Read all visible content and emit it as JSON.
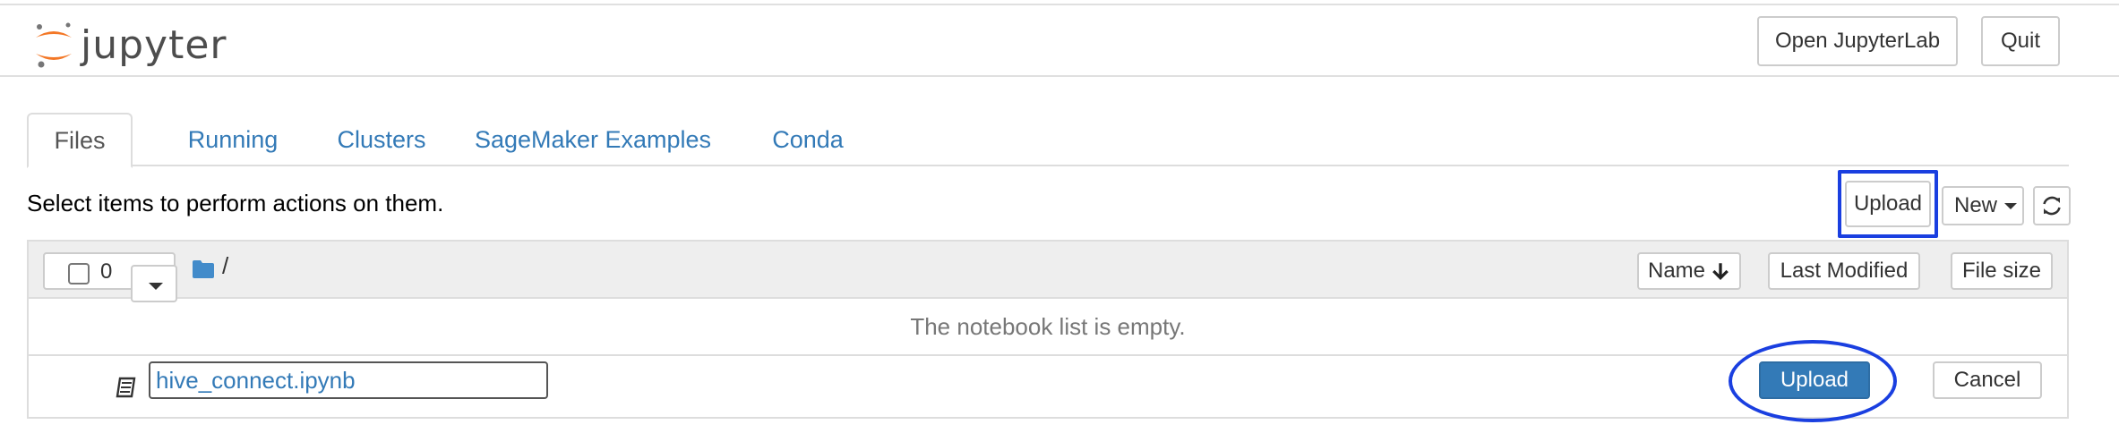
{
  "app": {
    "logo_text": "jupyter"
  },
  "header": {
    "open_jupyterlab_label": "Open JupyterLab",
    "quit_label": "Quit"
  },
  "tabs": [
    {
      "label": "Files",
      "active": true
    },
    {
      "label": "Running",
      "active": false
    },
    {
      "label": "Clusters",
      "active": false
    },
    {
      "label": "SageMaker Examples",
      "active": false
    },
    {
      "label": "Conda",
      "active": false
    }
  ],
  "toolbar": {
    "instructions": "Select items to perform actions on them.",
    "upload_label": "Upload",
    "new_label": "New",
    "refresh_icon": "refresh-icon"
  },
  "list_header": {
    "selected_count": "0",
    "path": "/",
    "name_label": "Name",
    "last_modified_label": "Last Modified",
    "file_size_label": "File size"
  },
  "list": {
    "empty_message": "The notebook list is empty."
  },
  "upload_row": {
    "filename": "hive_connect.ipynb",
    "upload_label": "Upload",
    "cancel_label": "Cancel"
  },
  "colors": {
    "link": "#337ab7",
    "primary": "#337ab7",
    "highlight": "#1a3fe0",
    "logo_orange": "#f37726"
  }
}
